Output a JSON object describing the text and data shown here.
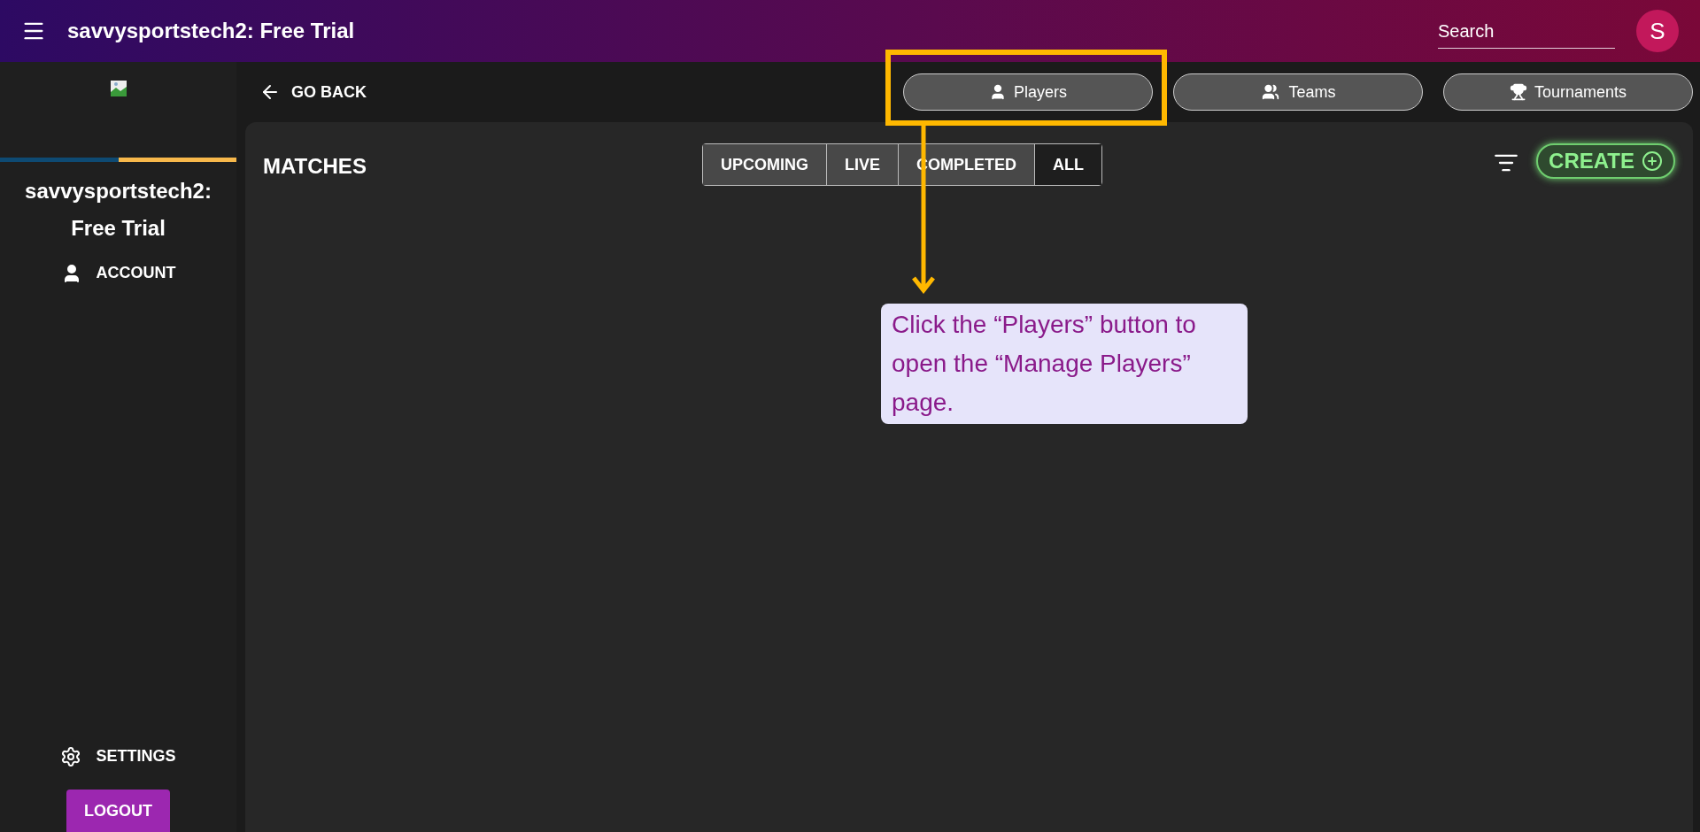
{
  "header": {
    "title": "savvysportstech2: Free Trial",
    "search": {
      "placeholder": "Search"
    },
    "avatar": "S"
  },
  "sidebar": {
    "title": "savvysportstech2: Free Trial",
    "items": [
      {
        "label": "ACCOUNT",
        "kind": "account"
      }
    ],
    "settings": "SETTINGS",
    "logout": "LOGOUT"
  },
  "go_back": "GO BACK",
  "nav_buttons": [
    {
      "label": "Players",
      "kind": "player"
    },
    {
      "label": "Teams",
      "kind": "team"
    },
    {
      "label": "Tournaments",
      "kind": "trophy"
    }
  ],
  "matches": {
    "title": "MATCHES",
    "filters": [
      {
        "label": "UPCOMING",
        "selected": false
      },
      {
        "label": "LIVE",
        "selected": false
      },
      {
        "label": "COMPLETED",
        "selected": false
      },
      {
        "label": "ALL",
        "selected": true
      }
    ],
    "create": "CREATE"
  },
  "annotation": {
    "text": "Click the “Players” button to open the “Manage Players” page."
  }
}
